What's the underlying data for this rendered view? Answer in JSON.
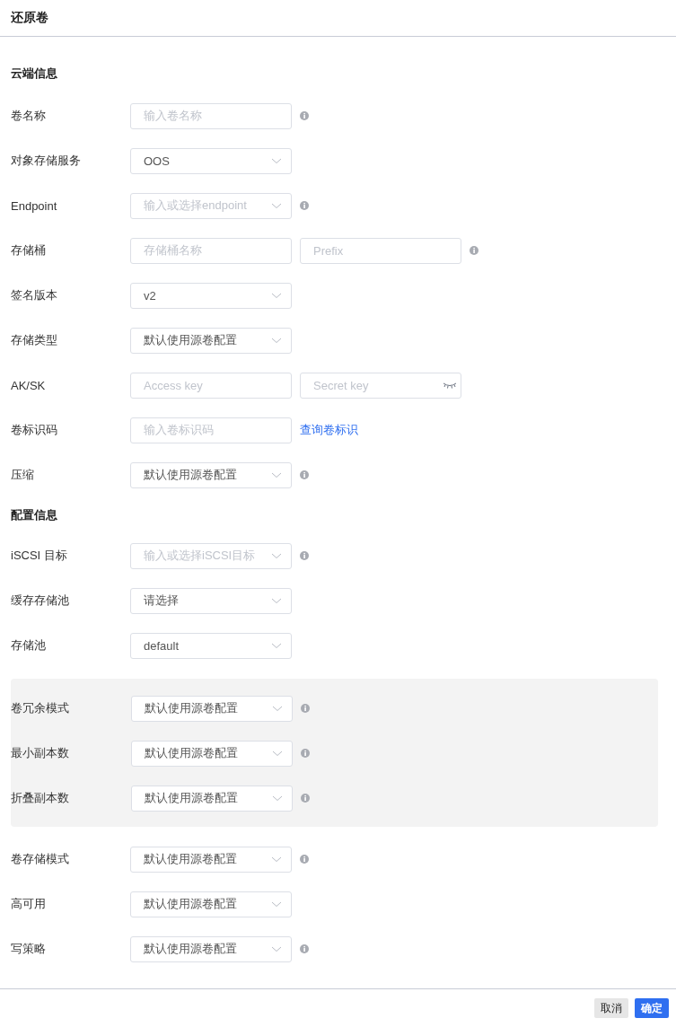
{
  "dialog": {
    "title": "还原卷"
  },
  "sections": [
    {
      "title": "云端信息",
      "items": [
        {
          "kind": "row",
          "label": "卷名称",
          "fields": [
            {
              "kind": "input",
              "placeholder": "输入卷名称"
            }
          ],
          "info": true
        },
        {
          "kind": "row",
          "label": "对象存储服务",
          "fields": [
            {
              "kind": "select",
              "value": "OOS"
            }
          ],
          "info": false
        },
        {
          "kind": "row",
          "label": "Endpoint",
          "fields": [
            {
              "kind": "select",
              "placeholder": "输入或选择endpoint"
            }
          ],
          "info": true
        },
        {
          "kind": "row",
          "label": "存储桶",
          "fields": [
            {
              "kind": "input",
              "placeholder": "存储桶名称"
            },
            {
              "kind": "input",
              "placeholder": "Prefix"
            }
          ],
          "info": true
        },
        {
          "kind": "row",
          "label": "签名版本",
          "fields": [
            {
              "kind": "select",
              "value": "v2"
            }
          ],
          "info": false
        },
        {
          "kind": "row",
          "label": "存储类型",
          "fields": [
            {
              "kind": "select",
              "value": "默认使用源卷配置"
            }
          ],
          "info": false
        },
        {
          "kind": "row",
          "label": "AK/SK",
          "fields": [
            {
              "kind": "input",
              "placeholder": "Access key"
            },
            {
              "kind": "password",
              "placeholder": "Secret key"
            }
          ],
          "info": false
        },
        {
          "kind": "row",
          "label": "卷标识码",
          "fields": [
            {
              "kind": "input",
              "placeholder": "输入卷标识码"
            }
          ],
          "info": false,
          "link": "查询卷标识"
        },
        {
          "kind": "row",
          "label": "压缩",
          "fields": [
            {
              "kind": "select",
              "value": "默认使用源卷配置"
            }
          ],
          "info": true
        }
      ]
    },
    {
      "title": "配置信息",
      "items": [
        {
          "kind": "row",
          "label": "iSCSI 目标",
          "fields": [
            {
              "kind": "select",
              "placeholder": "输入或选择iSCSI目标"
            }
          ],
          "info": true
        },
        {
          "kind": "row",
          "label": "缓存存储池",
          "fields": [
            {
              "kind": "select",
              "value": "请选择"
            }
          ],
          "info": false
        },
        {
          "kind": "row",
          "label": "存储池",
          "fields": [
            {
              "kind": "select",
              "value": "default"
            }
          ],
          "info": false
        },
        {
          "kind": "group",
          "rows": [
            {
              "kind": "row",
              "label": "卷冗余模式",
              "fields": [
                {
                  "kind": "select",
                  "value": "默认使用源卷配置"
                }
              ],
              "info": true
            },
            {
              "kind": "row",
              "label": "最小副本数",
              "fields": [
                {
                  "kind": "select",
                  "value": "默认使用源卷配置"
                }
              ],
              "info": true
            },
            {
              "kind": "row",
              "label": "折叠副本数",
              "fields": [
                {
                  "kind": "select",
                  "value": "默认使用源卷配置"
                }
              ],
              "info": true
            }
          ]
        },
        {
          "kind": "row",
          "label": "卷存储模式",
          "fields": [
            {
              "kind": "select",
              "value": "默认使用源卷配置"
            }
          ],
          "info": true
        },
        {
          "kind": "row",
          "label": "高可用",
          "fields": [
            {
              "kind": "select",
              "value": "默认使用源卷配置"
            }
          ],
          "info": false
        },
        {
          "kind": "row",
          "label": "写策略",
          "fields": [
            {
              "kind": "select",
              "value": "默认使用源卷配置"
            }
          ],
          "info": true
        }
      ]
    }
  ],
  "buttons": [
    {
      "label": "取消",
      "kind": "secondary"
    },
    {
      "label": "确定",
      "kind": "primary"
    }
  ]
}
